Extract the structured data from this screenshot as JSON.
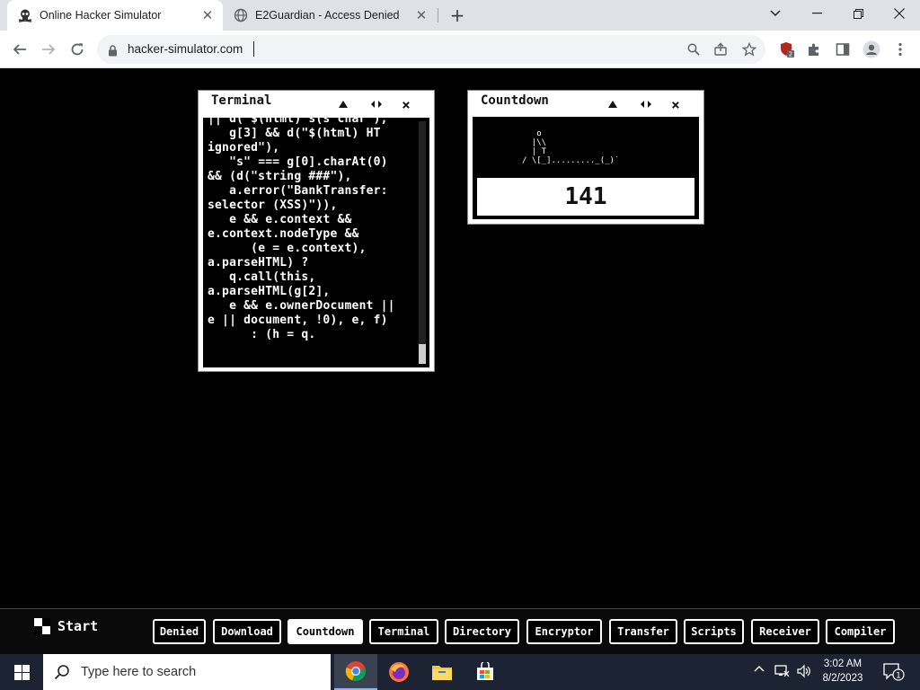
{
  "browser": {
    "tabs": [
      {
        "title": "Online Hacker Simulator",
        "active": true
      },
      {
        "title": "E2Guardian - Access Denied",
        "active": false
      }
    ],
    "url": "hacker-simulator.com",
    "extension_badge": "2"
  },
  "terminal": {
    "title": "Terminal",
    "code": "|| d( $(html) s(s char ),\n   g[3] && d(\"$(html) HT\nignored\"),\n   \"s\" === g[0].charAt(0)\n&& (d(\"string ###\"),\n   a.error(\"BankTransfer:\nselector (XSS)\")),\n   e && e.context &&\ne.context.nodeType &&\n      (e = e.context),\na.parseHTML) ?\n   q.call(this,\na.parseHTML(g[2],\n   e && e.ownerDocument ||\ne || document, !0), e, f)\n      : (h = q."
  },
  "countdown": {
    "title": "Countdown",
    "ascii": "   o\n  |\\\\\n  | T\n/ \\[_]........._(_)˙",
    "value": "141"
  },
  "window_controls": {
    "minimize": "▲",
    "move": "◆",
    "close": "×"
  },
  "simbar": {
    "start_label": "Start",
    "buttons": [
      {
        "label": "Denied",
        "style": "dark"
      },
      {
        "label": "Download",
        "style": "dark"
      },
      {
        "label": "Countdown",
        "style": "light"
      },
      {
        "label": "Terminal",
        "style": "dark"
      },
      {
        "label": "Directory",
        "style": "dark"
      },
      {
        "label": "Encryptor",
        "style": "dark"
      },
      {
        "label": "Transfer",
        "style": "dark"
      },
      {
        "label": "Scripts",
        "style": "dark"
      },
      {
        "label": "Receiver",
        "style": "dark"
      },
      {
        "label": "Compiler",
        "style": "dark"
      }
    ]
  },
  "windows_taskbar": {
    "search_placeholder": "Type here to search",
    "time": "3:02 AM",
    "date": "8/2/2023",
    "notification_count": "1"
  }
}
